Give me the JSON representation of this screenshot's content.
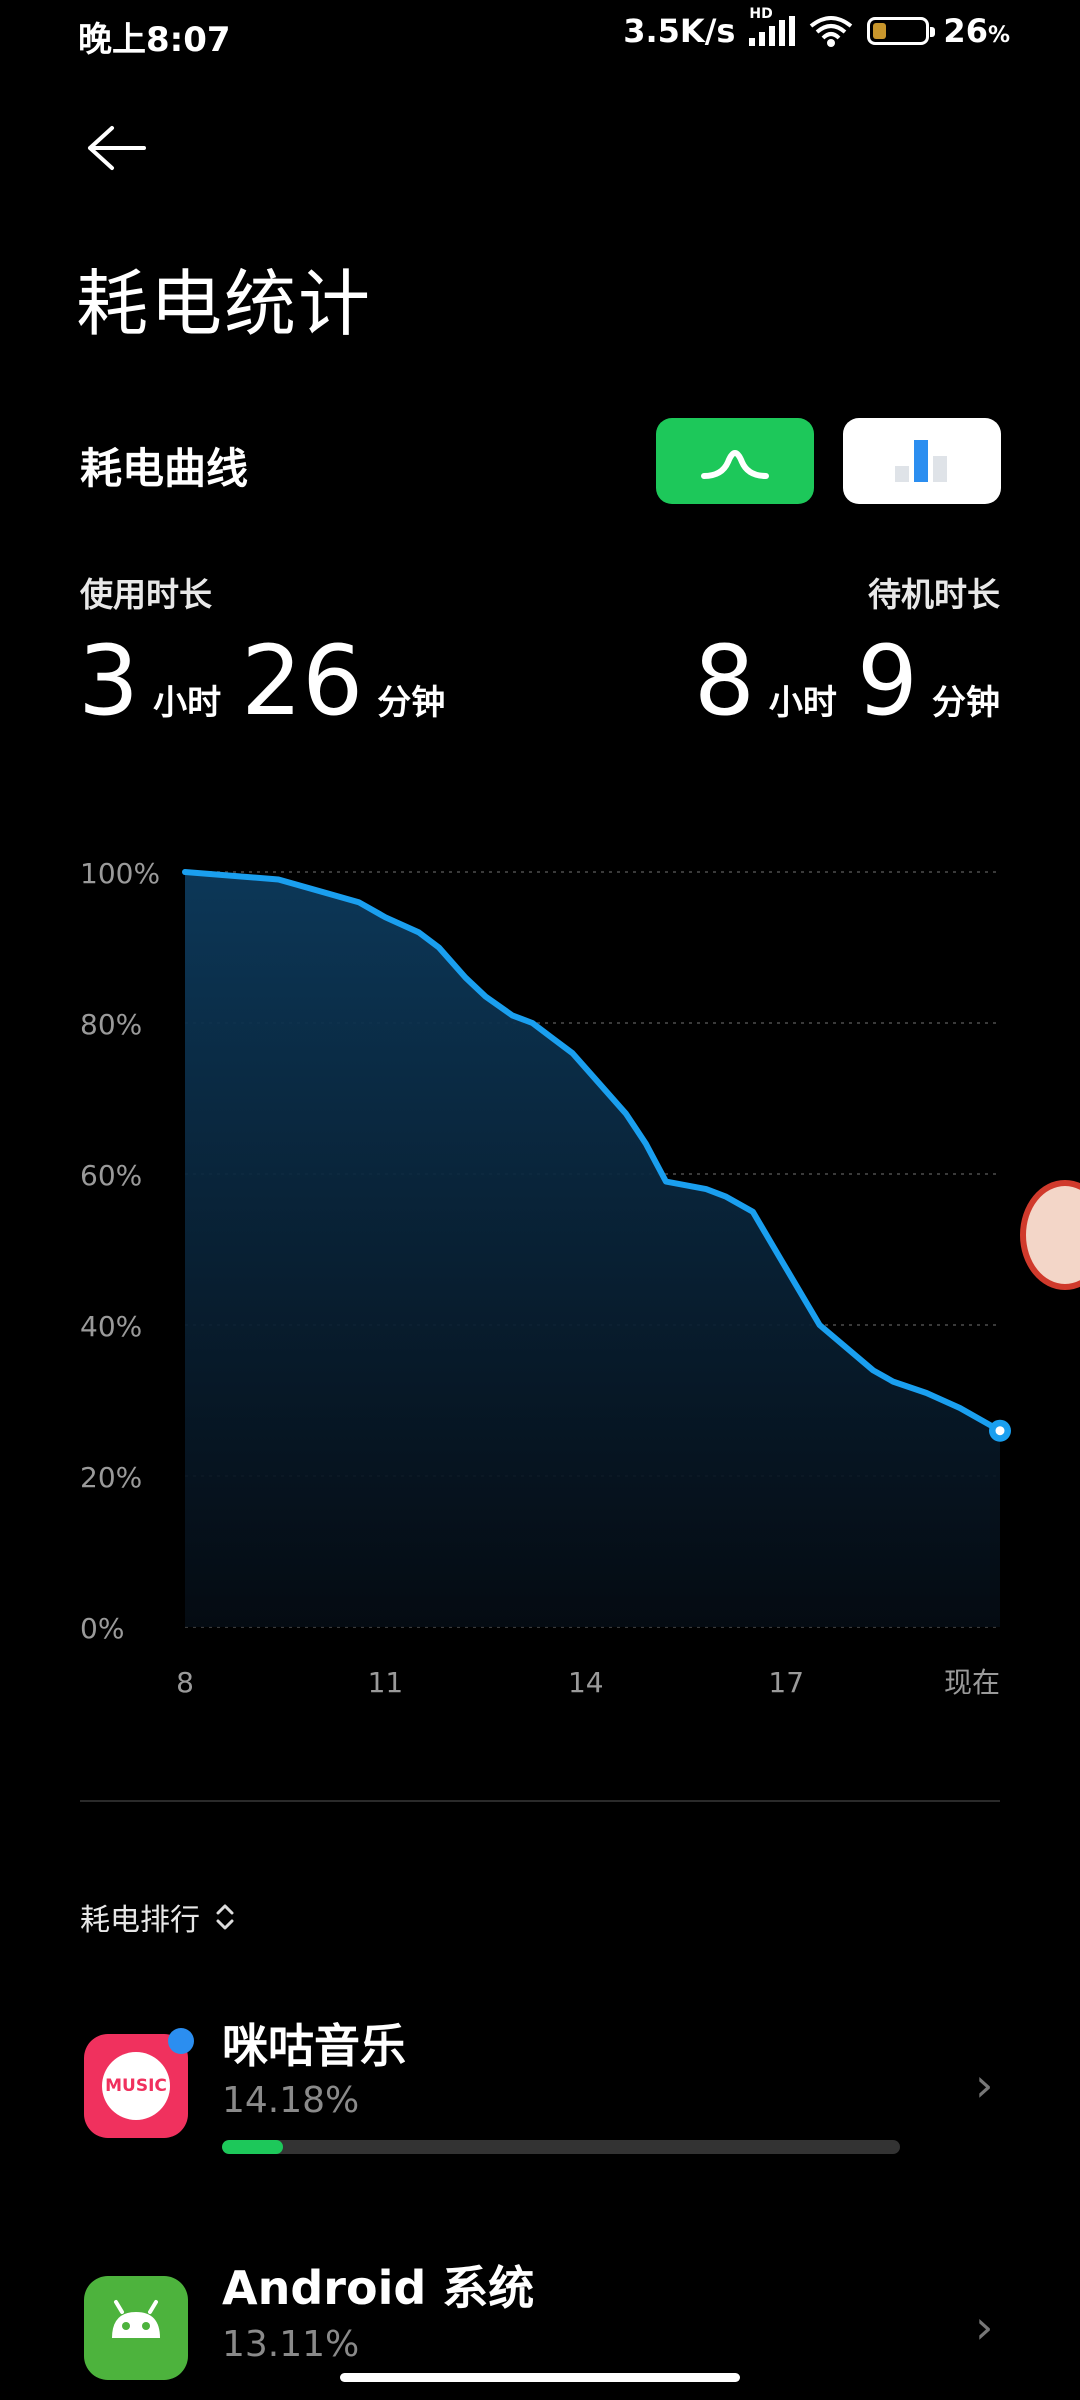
{
  "status_bar": {
    "time": "晚上8:07",
    "net_speed": "3.5K/s",
    "net_type": "HD",
    "battery": "26",
    "battery_unit": "%",
    "battery_level": 0.26
  },
  "page": {
    "title": "耗电统计"
  },
  "curve": {
    "label": "耗电曲线",
    "toggle_curve_icon": "curve-icon",
    "toggle_bar_icon": "bar-chart-icon"
  },
  "usage": {
    "active_label": "使用时长",
    "active_hours": "3",
    "active_minutes": "26",
    "standby_label": "待机时长",
    "standby_hours": "8",
    "standby_minutes": "9",
    "hour_unit": "小时",
    "minute_unit": "分钟"
  },
  "chart_data": {
    "type": "area",
    "y_tick_labels": [
      "100%",
      "80%",
      "60%",
      "40%",
      "20%",
      "0%"
    ],
    "x_tick_labels": [
      "8",
      "11",
      "14",
      "17",
      "现在"
    ],
    "ylim": [
      0,
      100
    ],
    "line_color": "#1a9fef",
    "grid": true,
    "series": [
      {
        "x": [
          8,
          9.4,
          10.6,
          11,
          11.5,
          11.8,
          12.2,
          12.5,
          12.9,
          13.2,
          13.5,
          13.8,
          14.2,
          14.6,
          14.9,
          15.2,
          15.8,
          16.1,
          16.5,
          16.9,
          17.5,
          18.3,
          18.6,
          19.1,
          19.6,
          20.2
        ],
        "y": [
          100,
          99,
          96,
          94,
          92,
          90,
          86,
          83.5,
          81,
          80,
          78,
          76,
          72,
          68,
          64,
          59,
          58,
          57,
          55,
          49,
          40,
          34,
          32.5,
          31,
          29,
          26
        ]
      }
    ]
  },
  "ranking": {
    "label": "耗电排行",
    "apps": [
      {
        "name": "咪咕音乐",
        "percent": "14.18%",
        "bar": 0.09,
        "icon": "migu-music-icon",
        "icon_text": "MUSIC",
        "color": "#f0315e"
      },
      {
        "name": "Android 系统",
        "percent": "13.11%",
        "icon": "android-icon",
        "color": "#4db33d"
      }
    ]
  }
}
